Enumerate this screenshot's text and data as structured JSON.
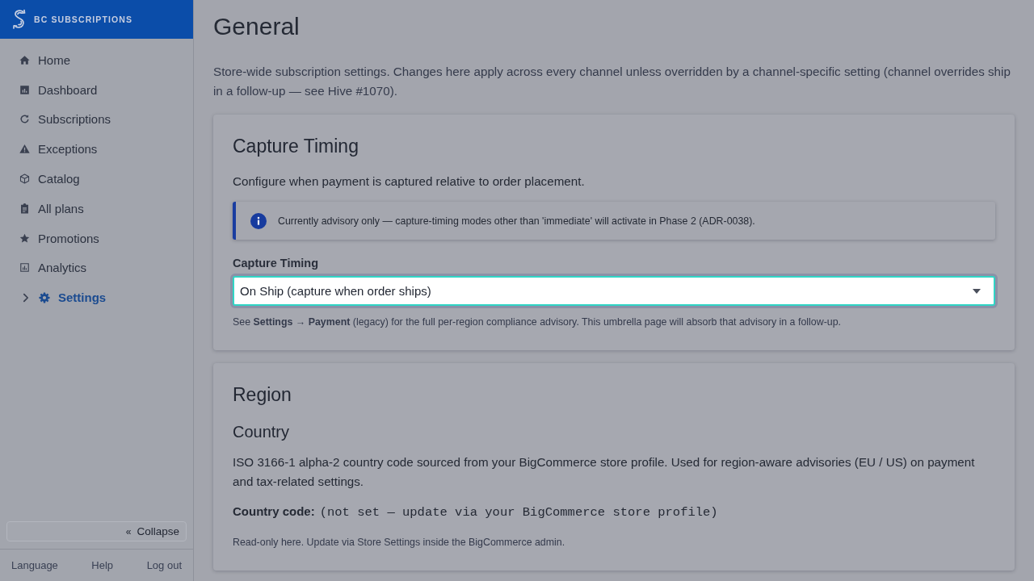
{
  "sidebar": {
    "brand": "BC SUBSCRIPTIONS",
    "items": [
      {
        "label": "Home",
        "kind": "link",
        "selected": false
      },
      {
        "label": "Dashboard",
        "kind": "link",
        "selected": false
      },
      {
        "label": "Subscriptions",
        "kind": "link",
        "selected": false
      },
      {
        "label": "Exceptions",
        "kind": "link",
        "selected": false
      },
      {
        "label": "Catalog",
        "kind": "link",
        "selected": false
      },
      {
        "label": "All plans",
        "kind": "link",
        "selected": false
      },
      {
        "label": "Promotions",
        "kind": "link",
        "selected": false
      },
      {
        "label": "Analytics",
        "kind": "link",
        "selected": false
      },
      {
        "label": "Settings",
        "kind": "group",
        "selected": true,
        "expanded": false
      }
    ],
    "collapse_button": {
      "icon": "«",
      "label": "Collapse"
    },
    "footer_links": [
      "Language",
      "Help",
      "Log out"
    ]
  },
  "page": {
    "title": "General",
    "description": "Store-wide subscription settings. Changes here apply across every channel unless overridden by a channel-specific setting (channel overrides ship in a follow-up — see Hive #1070)."
  },
  "sections": [
    {
      "title": "Capture Timing",
      "blocks": [
        {
          "kind": "paragraph",
          "text": "Configure when payment is captured relative to order placement."
        },
        {
          "kind": "callout",
          "text": "Currently advisory only — capture-timing modes other than 'immediate' will activate in Phase 2 (ADR-0038)."
        },
        {
          "kind": "select",
          "label": "Capture Timing",
          "value": "On Ship (capture when order ships)",
          "focused": true,
          "help": "See **Settings** → **Payment** (legacy) for the full per-region compliance advisory. This umbrella page will absorb that advisory in a follow-up."
        }
      ]
    },
    {
      "title": "Region",
      "blocks": [
        {
          "kind": "subheading",
          "text": "Country"
        },
        {
          "kind": "paragraph",
          "text": "ISO 3166-1 alpha-2 country code sourced from your BigCommerce store profile. Used for region-aware advisories (EU / US) on payment and tax-related settings."
        },
        {
          "kind": "readonly_field",
          "label": "Country code:",
          "value": "(not set — update via your BigCommerce store profile)"
        },
        {
          "kind": "note",
          "text": "Read-only here. Update via Store Settings inside the BigCommerce admin."
        }
      ]
    }
  ]
}
